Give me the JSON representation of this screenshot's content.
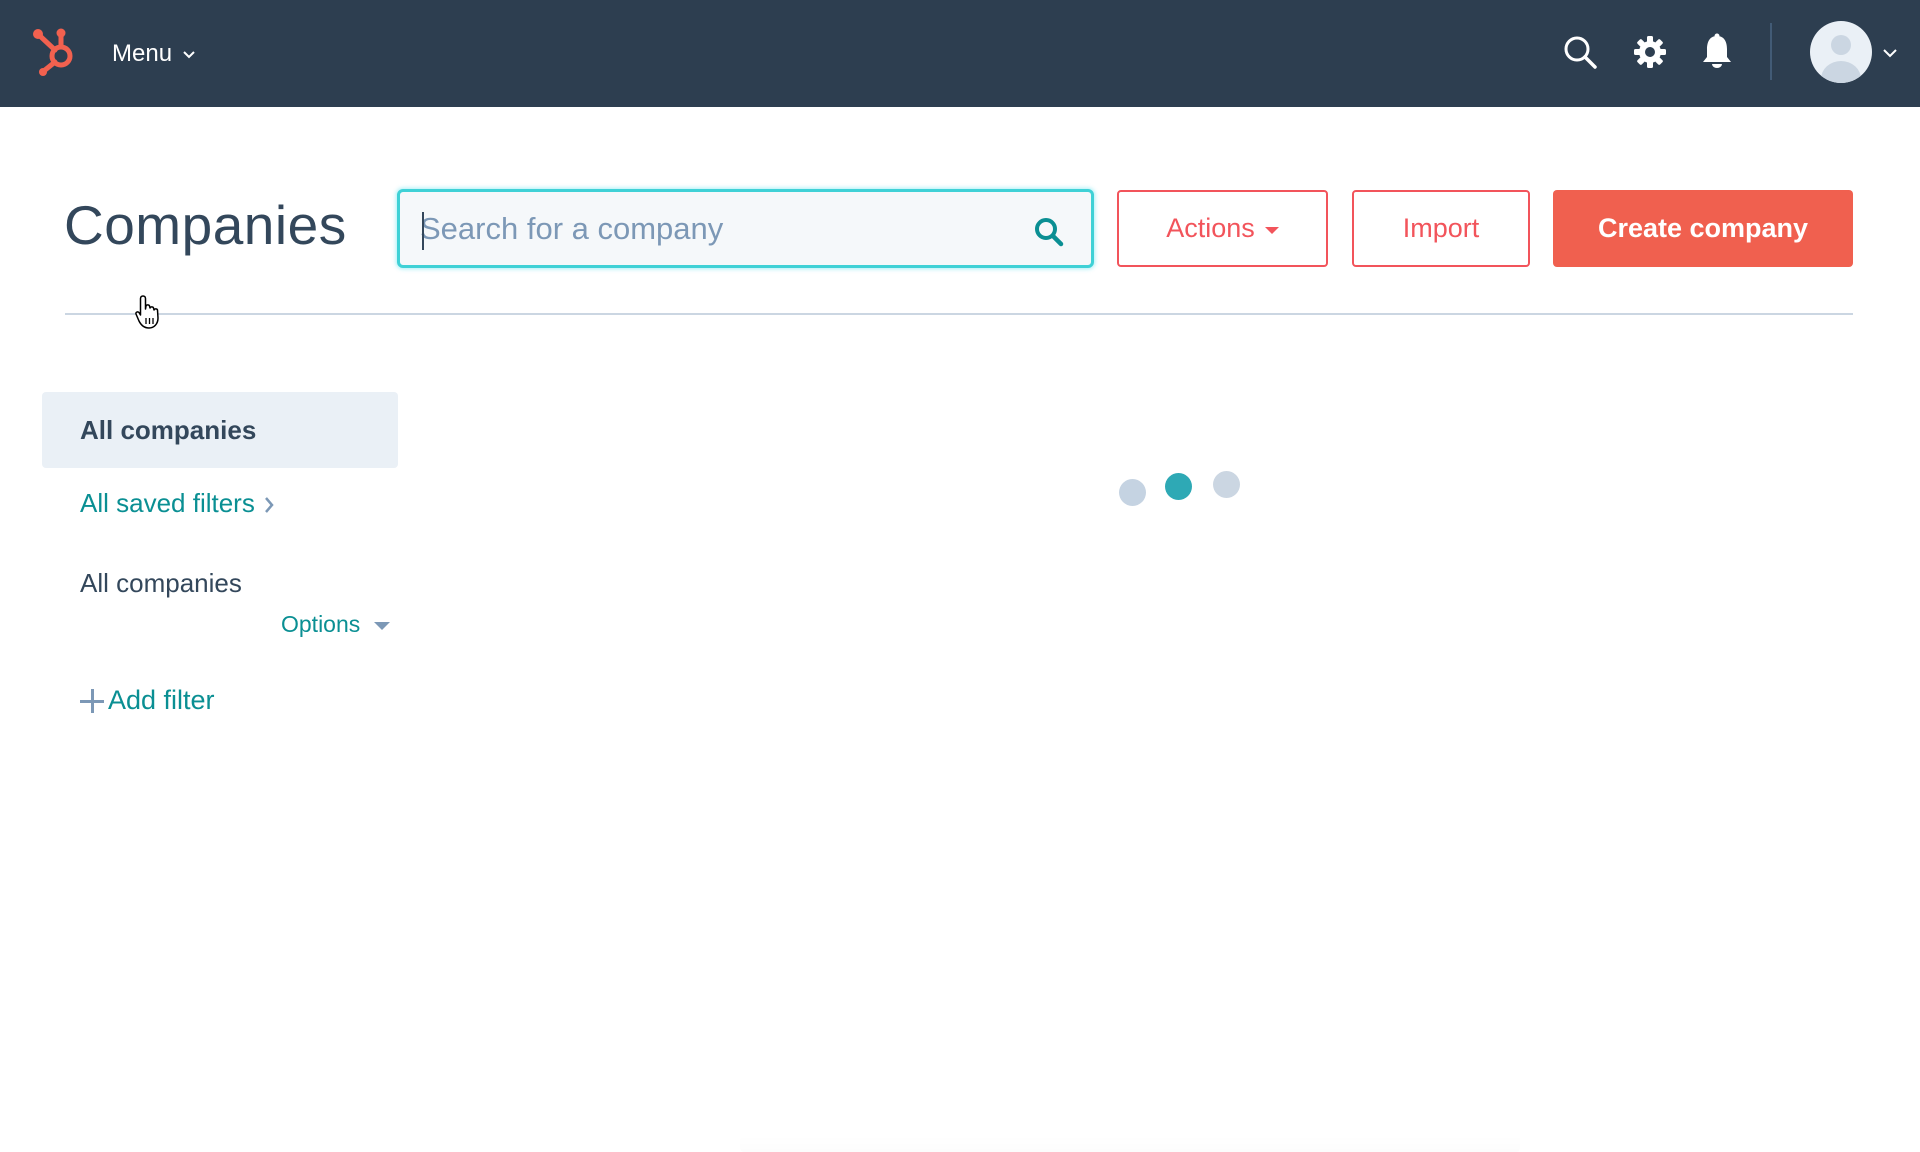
{
  "topnav": {
    "menu_label": "Menu",
    "icons": [
      "hubspot-logo",
      "search-icon",
      "settings-gear-icon",
      "notifications-bell-icon",
      "user-avatar",
      "chevron-down-icon"
    ],
    "colors": {
      "background": "#2d3e50",
      "logo": "#f2614f"
    }
  },
  "header": {
    "title": "Companies",
    "search": {
      "placeholder": "Search for a company",
      "value": ""
    },
    "actions_label": "Actions",
    "import_label": "Import",
    "create_label": "Create company",
    "colors": {
      "primary": "#f0604f",
      "search_focus": "#3fd1d6"
    }
  },
  "sidebar": {
    "active_view": "All companies",
    "saved_filters_link": "All saved filters",
    "current_view_name": "All companies",
    "options_label": "Options",
    "add_filter_label": "Add filter",
    "colors": {
      "link": "#0a8f93",
      "active_bg": "#eaf0f6"
    }
  },
  "main": {
    "state": "loading",
    "loader": {
      "dots": 3,
      "active_dot": 2,
      "active_color": "#2ea9b5",
      "inactive_color": "#cbd6e2"
    }
  }
}
